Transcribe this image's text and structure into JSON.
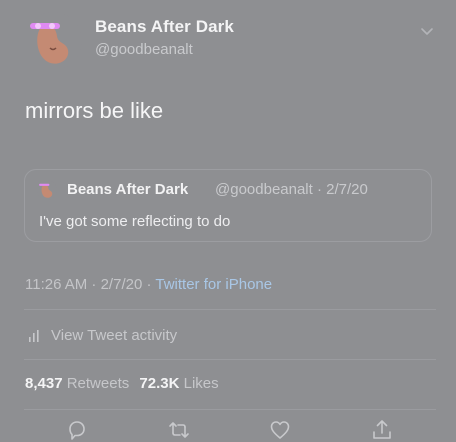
{
  "author": {
    "display_name": "Beans After Dark",
    "handle": "@goodbeanalt"
  },
  "tweet": {
    "text": "mirrors be like",
    "timestamp": "11:26 AM · 2/7/20",
    "separator": " · ",
    "source": "Twitter for iPhone"
  },
  "quoted_tweet": {
    "display_name": "Beans After Dark",
    "meta": "@goodbeanalt · 2/7/20",
    "text": "I've got some reflecting to do"
  },
  "activity_label": "View Tweet activity",
  "stats": {
    "retweets_count": "8,437",
    "retweets_label": "Retweets",
    "likes_count": "72.3K",
    "likes_label": "Likes"
  },
  "icons": {
    "chevron": "chevron-down-icon",
    "activity": "bar-chart-icon",
    "reply": "reply-icon",
    "retweet": "retweet-icon",
    "like": "heart-icon",
    "share": "share-icon"
  },
  "colors": {
    "background": "#8e8f92",
    "avatar_bean": "#c48a73",
    "avatar_eyes": "#e08af2",
    "source_link": "#a9c7e6"
  }
}
